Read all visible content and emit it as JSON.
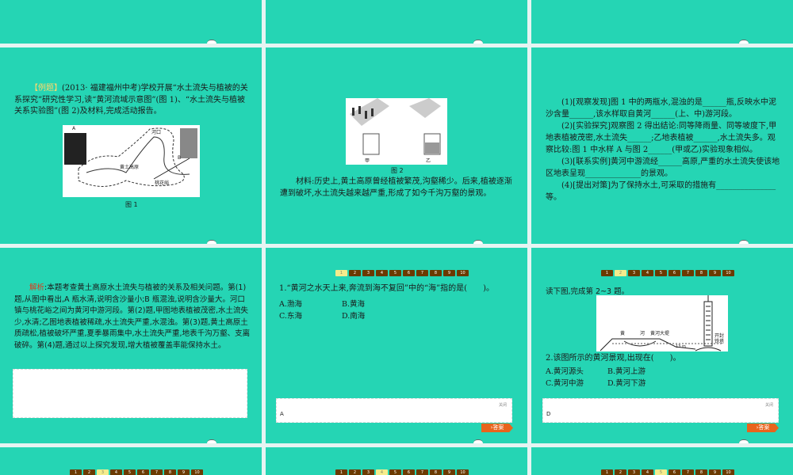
{
  "pager": [
    "1",
    "2",
    "3",
    "4",
    "5",
    "6",
    "7",
    "8",
    "9",
    "10"
  ],
  "slide_example": {
    "tag": "【例题】",
    "text": "(2013· 福建福州中考)学校开展“水土流失与植被的关系探究”研究性学习,读“黄河流域示意图”(图 1)、“水土流失与植被关系实验图”(图 2)及材料,完成活动报告。",
    "fig_labels": {
      "a": "A",
      "b": "B",
      "hekou": "河口",
      "plateau": "黄土高原",
      "taohuayu": "桃花峪"
    },
    "caption": "图 1"
  },
  "slide_material": {
    "fig_labels": {
      "jia": "甲",
      "yi": "乙"
    },
    "caption": "图 2",
    "text": "材料:历史上,黄土高原曾经植被繁茂,沟壑稀少。后来,植被逐渐遭到破坏,水土流失越来越严重,形成了如今千沟万壑的景观。"
  },
  "slide_questions": {
    "q1": "(1)[观察发现]图 1 中的两瓶水,混浊的是______瓶,反映水中泥沙含量______,该水样取自黄河______(上、中)游河段。",
    "q2": "(2)[实验探究]观察图 2 得出结论:同等降雨量、同等坡度下,甲地表植被茂密,水土流失______;乙地表植被______,水土流失多。观察比较:图 1 中水样 A 与图 2______(甲或乙)实验现象相似。",
    "q3": "(3)[联系实例]黄河中游流经______高原,严重的水土流失使该地区地表呈现______________的景观。",
    "q4": "(4)[提出对策]为了保持水土,可采取的措施有_______________等。"
  },
  "slide_analysis": {
    "label": "解析",
    "text": ":本题考查黄土高原水土流失与植被的关系及相关问题。第(1)题,从图中看出,A 瓶水清,说明含沙量小;B 瓶混浊,说明含沙量大。河口镇与桃花峪之间为黄河中游河段。第(2)题,甲图地表植被茂密,水土流失少,水清;乙图地表植被稀疏,水土流失严重,水混浊。第(3)题,黄土高原土质疏松,植被破坏严重,夏季暴雨集中,水土流失严重,地表千沟万壑、支离破碎。第(4)题,通过以上探究发现,增大植被覆盖率能保持水土。"
  },
  "slide_q1": {
    "active_page": 1,
    "question": "1.“黄河之水天上来,奔流到海不复回”中的“海”指的是(　　)。",
    "options": [
      "A.渤海",
      "B.黄海",
      "C.东海",
      "D.南海"
    ],
    "close": "关闭",
    "answer": "A",
    "answer_button": "答案"
  },
  "slide_q2": {
    "active_page": 2,
    "intro": "读下图,完成第 2~3 题。",
    "fig_labels": {
      "river1": "黄",
      "river2": "河",
      "dam": "黄河大堤",
      "height": "13 m",
      "tower": "开封铁塔"
    },
    "question": "2.该图所示的黄河景观,出现在(　　)。",
    "options": [
      "A.黄河源头",
      "B.黄河上游",
      "C.黄河中游",
      "D.黄河下游"
    ],
    "close": "关闭",
    "answer": "D",
    "answer_button": "答案"
  },
  "bottom_row_active_pages": [
    3,
    4,
    5
  ]
}
